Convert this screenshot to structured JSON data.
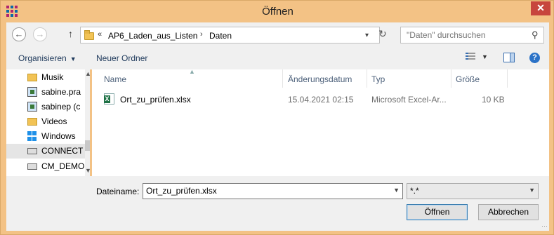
{
  "window": {
    "title": "Öffnen",
    "close_glyph": "✕"
  },
  "nav": {
    "back_glyph": "←",
    "forward_glyph": "→",
    "up_glyph": "↑",
    "refresh_glyph": "↻"
  },
  "address": {
    "overflow": "«",
    "crumbs": [
      "AP6_Laden_aus_Listen",
      "Daten"
    ],
    "sep": "›",
    "dropdown": "▾"
  },
  "search": {
    "placeholder": "\"Daten\" durchsuchen",
    "icon": "search-icon"
  },
  "toolbar": {
    "organize": "Organisieren",
    "new_folder": "Neuer Ordner",
    "help": "?"
  },
  "sidebar": {
    "items": [
      {
        "label": "Musik",
        "icon": "music-folder-icon"
      },
      {
        "label": "sabine.pra",
        "icon": "network-user-icon"
      },
      {
        "label": "sabinep (c",
        "icon": "network-user-icon"
      },
      {
        "label": "Videos",
        "icon": "videos-folder-icon"
      },
      {
        "label": "Windows",
        "icon": "windows-drive-icon"
      },
      {
        "label": "CONNECT",
        "icon": "network-drive-icon",
        "selected": true
      },
      {
        "label": "CM_DEMO",
        "icon": "drive-icon"
      }
    ]
  },
  "columns": {
    "name": "Name",
    "modified": "Änderungsdatum",
    "type": "Typ",
    "size": "Größe"
  },
  "files": [
    {
      "name": "Ort_zu_prüfen.xlsx",
      "modified": "15.04.2021 02:15",
      "type": "Microsoft Excel-Ar...",
      "size": "10 KB",
      "icon": "excel-file-icon"
    }
  ],
  "bottom": {
    "filename_label": "Dateiname:",
    "filename_value": "Ort_zu_prüfen.xlsx",
    "filter_value": "*.*",
    "open_button": "Öffnen",
    "cancel_button": "Abbrechen"
  },
  "colors": {
    "frame": "#f3c285",
    "close": "#c7453d",
    "accent": "#2b72c7"
  }
}
